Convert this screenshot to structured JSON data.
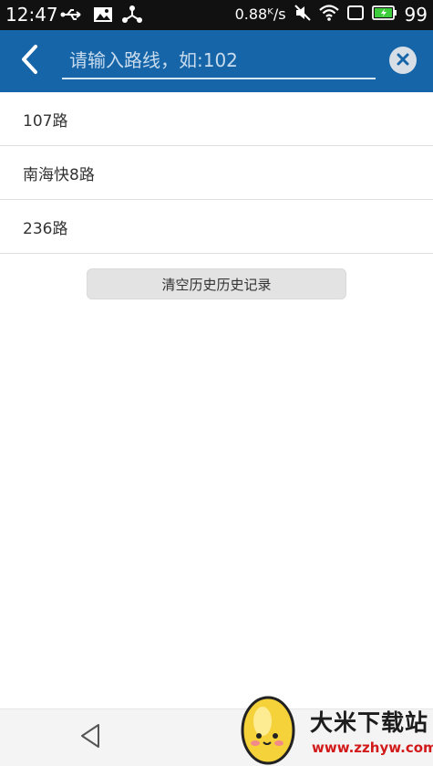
{
  "status_bar": {
    "time": "12:47",
    "net_speed": "0.88ᴷ/s",
    "battery": "99",
    "icons": [
      "usb-icon",
      "image-icon",
      "share-icon",
      "mute-icon",
      "wifi-icon",
      "screen-icon",
      "battery-icon"
    ]
  },
  "search": {
    "placeholder": "请输入路线，如:102",
    "value": ""
  },
  "history": {
    "items": [
      {
        "label": "107路"
      },
      {
        "label": "南海快8路"
      },
      {
        "label": "236路"
      }
    ],
    "clear_label": "清空历史历史记录"
  },
  "watermark": {
    "title": "大米下载站",
    "url": "www.zzhyw.com"
  },
  "colors": {
    "header": "#1565a8",
    "status_bar": "#111111",
    "divider": "#dedede",
    "button_bg": "#e3e3e3"
  }
}
